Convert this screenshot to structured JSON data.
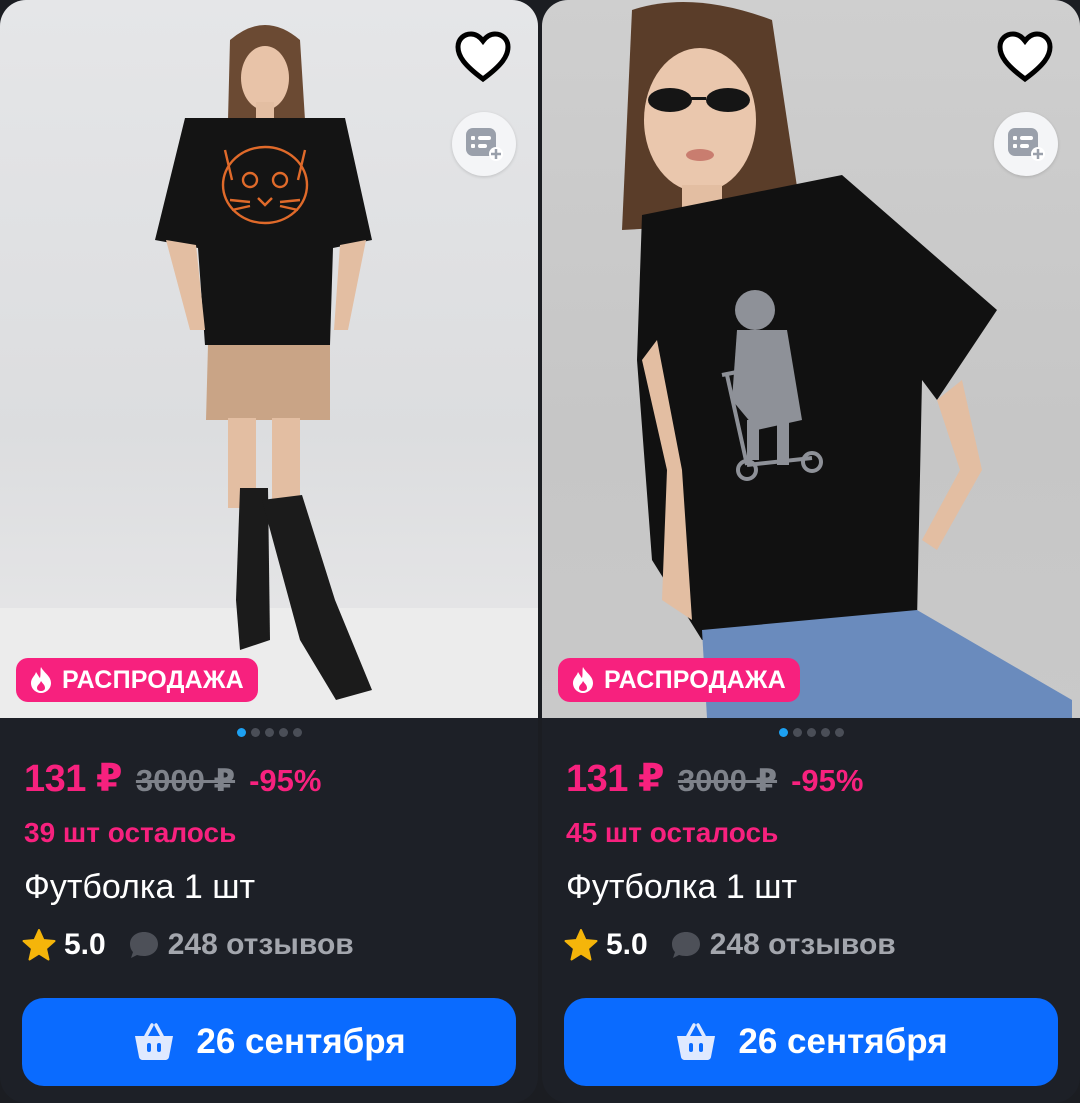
{
  "colors": {
    "accent_pink": "#f7217e",
    "button_blue": "#0a6bff",
    "card_bg": "#1d2027",
    "star": "#f5b50a"
  },
  "cards": [
    {
      "sale_badge": "РАСПРОДАЖА",
      "price_current": "131 ₽",
      "price_old": "3000 ₽",
      "discount": "-95%",
      "stock": "39 шт осталось",
      "title": "Футболка 1 шт",
      "rating": "5.0",
      "reviews": "248 отзывов",
      "delivery_button": "26 сентября",
      "image_count": 5,
      "image_index": 1
    },
    {
      "sale_badge": "РАСПРОДАЖА",
      "price_current": "131 ₽",
      "price_old": "3000 ₽",
      "discount": "-95%",
      "stock": "45 шт осталось",
      "title": "Футболка 1 шт",
      "rating": "5.0",
      "reviews": "248 отзывов",
      "delivery_button": "26 сентября",
      "image_count": 5,
      "image_index": 1
    }
  ],
  "icons": {
    "favorite": "heart-outline-icon",
    "compare": "compare-list-add-icon",
    "sale": "fire-icon",
    "rating": "star-icon",
    "reviews": "chat-bubble-icon",
    "cart": "basket-icon"
  }
}
